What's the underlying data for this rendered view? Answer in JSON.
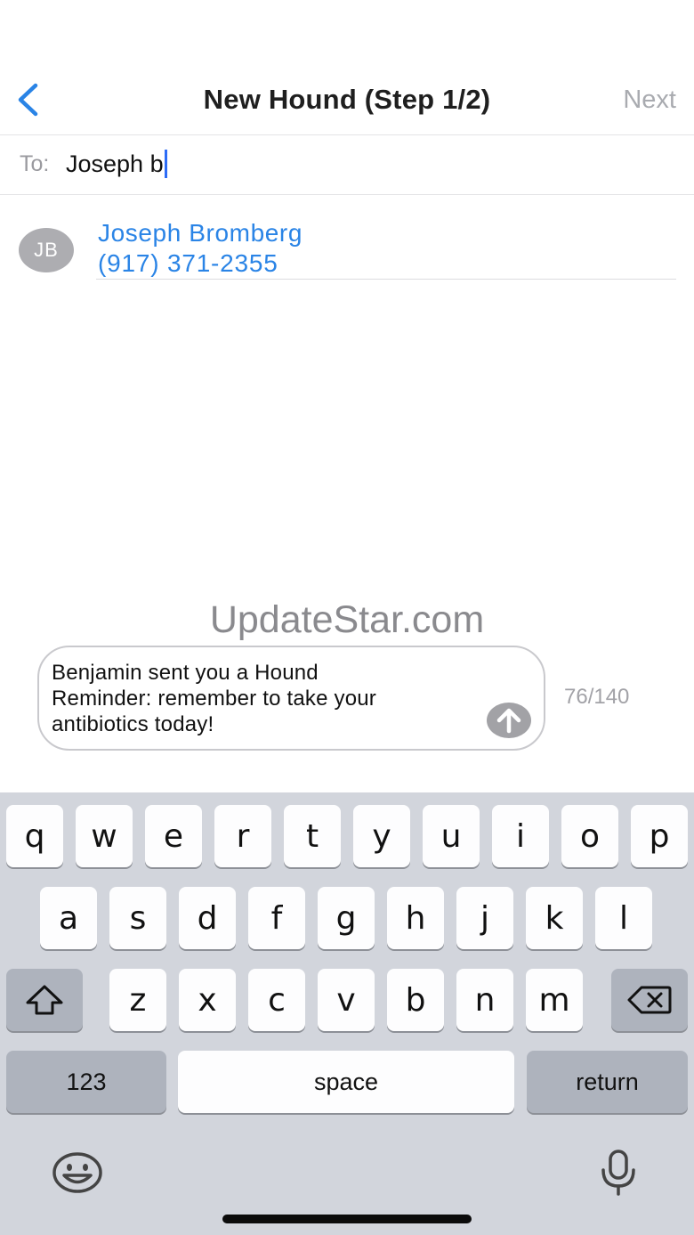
{
  "nav": {
    "title": "New Hound (Step 1/2)",
    "next_label": "Next",
    "back_icon": "chevron-left-icon"
  },
  "to_field": {
    "label": "To:",
    "value": "Joseph b"
  },
  "suggestion": {
    "initials": "JB",
    "name": "Joseph Bromberg",
    "phone": "(917) 371-2355"
  },
  "watermark": "UpdateStar.com",
  "message": {
    "text": "Benjamin sent you a Hound\nReminder: remember to take your\nantibiotics today!",
    "counter": "76/140",
    "send_icon": "arrow-up-circle-icon"
  },
  "keyboard": {
    "row1": [
      "q",
      "w",
      "e",
      "r",
      "t",
      "y",
      "u",
      "i",
      "o",
      "p"
    ],
    "row2": [
      "a",
      "s",
      "d",
      "f",
      "g",
      "h",
      "j",
      "k",
      "l"
    ],
    "row3": [
      "z",
      "x",
      "c",
      "v",
      "b",
      "n",
      "m"
    ],
    "numbers_label": "123",
    "space_label": "space",
    "return_label": "return",
    "shift_icon": "shift-icon",
    "delete_icon": "backspace-icon",
    "emoji_icon": "emoji-icon",
    "mic_icon": "microphone-icon"
  },
  "colors": {
    "accent": "#2a84e6",
    "caret": "#2d6cf6",
    "keyboard_bg": "#d2d5dc"
  }
}
